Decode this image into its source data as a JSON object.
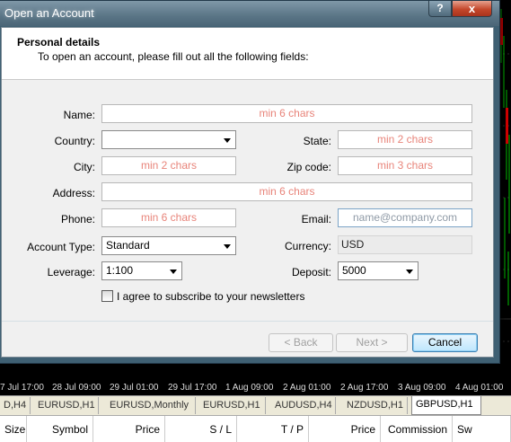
{
  "dialog": {
    "title": "Open an Account",
    "help_label": "?",
    "close_label": "x",
    "header_title": "Personal details",
    "header_subtitle": "To open an account, please fill out all the following fields:"
  },
  "form": {
    "name": {
      "label": "Name:",
      "placeholder": "min 6 chars"
    },
    "country": {
      "label": "Country:",
      "value": ""
    },
    "state": {
      "label": "State:",
      "placeholder": "min 2 chars"
    },
    "city": {
      "label": "City:",
      "placeholder": "min 2 chars"
    },
    "zip": {
      "label": "Zip code:",
      "placeholder": "min 3 chars"
    },
    "address": {
      "label": "Address:",
      "placeholder": "min 6 chars"
    },
    "phone": {
      "label": "Phone:",
      "placeholder": "min 6 chars"
    },
    "email": {
      "label": "Email:",
      "placeholder": "name@company.com"
    },
    "account_type": {
      "label": "Account Type:",
      "value": "Standard"
    },
    "currency": {
      "label": "Currency:",
      "value": "USD"
    },
    "leverage": {
      "label": "Leverage:",
      "value": "1:100"
    },
    "deposit": {
      "label": "Deposit:",
      "value": "5000"
    },
    "newsletter": {
      "label": "I agree to subscribe to your newsletters",
      "checked": false
    }
  },
  "buttons": {
    "back": "< Back",
    "next": "Next >",
    "cancel": "Cancel"
  },
  "time_axis": [
    "7 Jul 17:00",
    "28 Jul 09:00",
    "29 Jul 01:00",
    "29 Jul 17:00",
    "1 Aug 09:00",
    "2 Aug 01:00",
    "2 Aug 17:00",
    "3 Aug 09:00",
    "4 Aug 01:00"
  ],
  "chart_tabs": [
    "D,H4",
    "EURUSD,H1",
    "EURUSD,Monthly",
    "EURUSD,H1",
    "AUDUSD,H4",
    "NZDUSD,H1",
    "GBPUSD,H1"
  ],
  "active_chart_tab": "GBPUSD,H1",
  "terminal_columns": [
    "Size",
    "Symbol",
    "Price",
    "S / L",
    "T / P",
    "Price",
    "Commission",
    "Sw"
  ],
  "colors": {
    "placeholder_red": "#e8847a",
    "placeholder_email": "#8f9aa6",
    "title_bar": "#5a7586",
    "close_button": "#c4472b"
  }
}
